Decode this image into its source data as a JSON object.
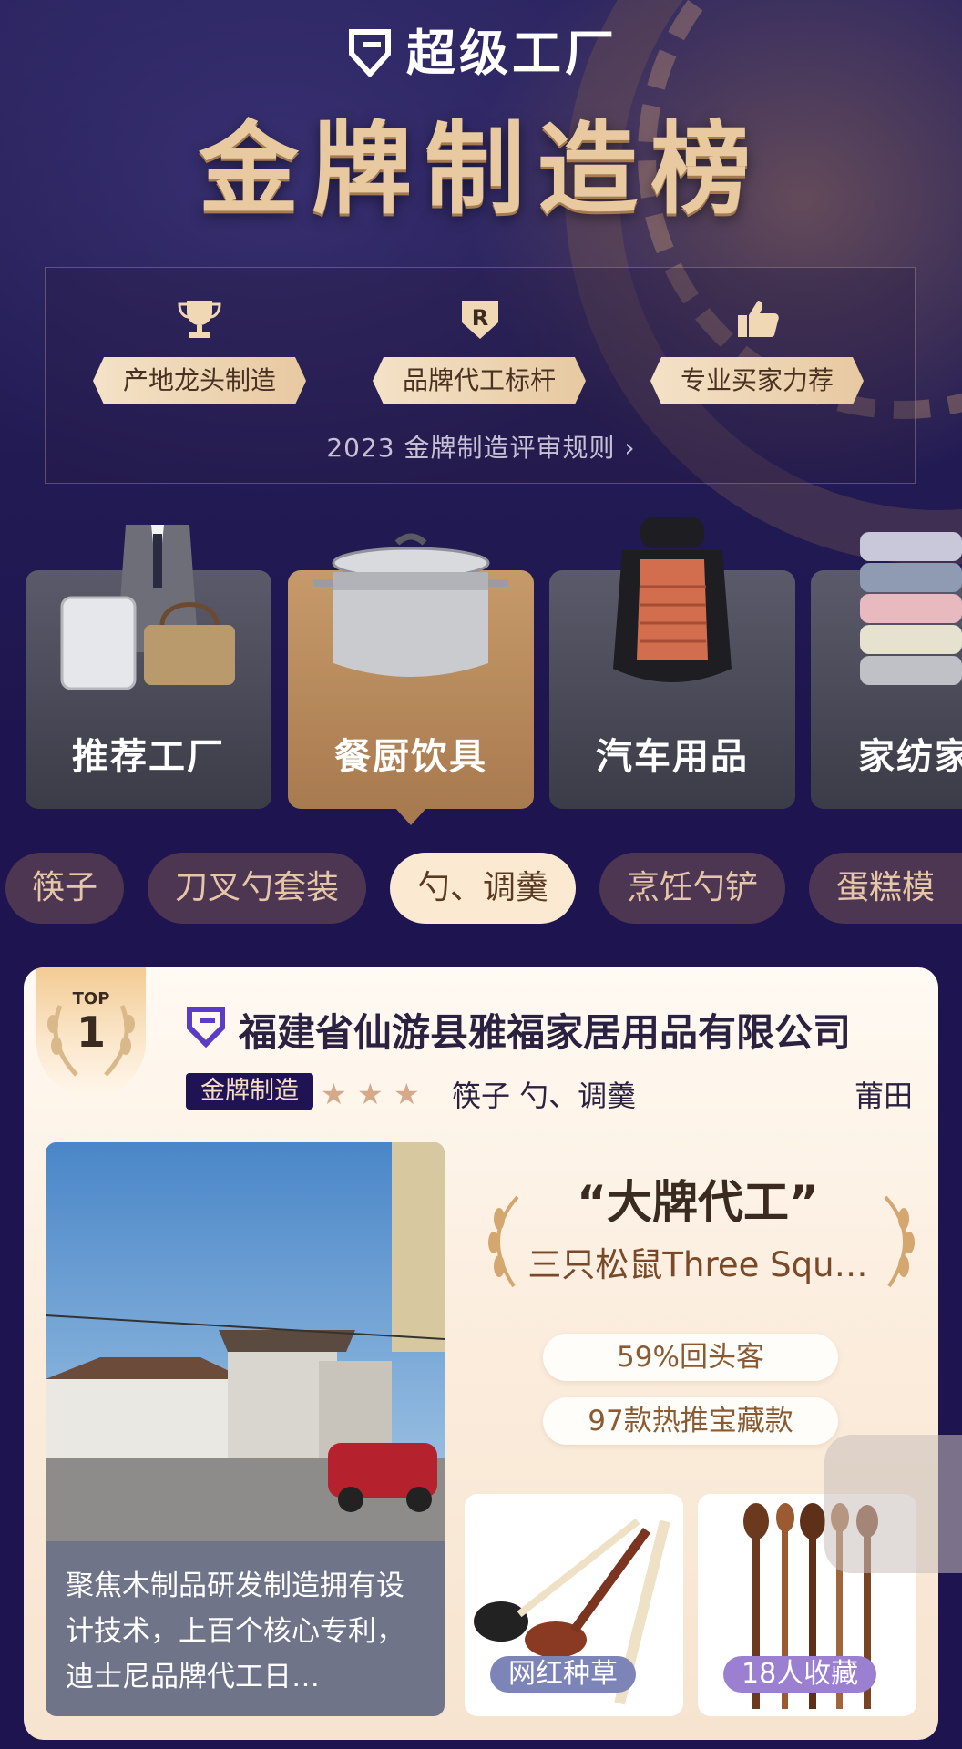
{
  "header": {
    "brand": "超级工厂",
    "title": "金牌制造榜",
    "badges": [
      {
        "icon": "trophy-icon",
        "label": "产地龙头制造"
      },
      {
        "icon": "registered-shield-icon",
        "label": "品牌代工标杆"
      },
      {
        "icon": "thumbs-up-icon",
        "label": "专业买家力荐"
      }
    ],
    "rules_link": "2023 金牌制造评审规则 ›"
  },
  "categories": [
    {
      "label": "推荐工厂",
      "icon": "suit-luggage-icon",
      "active": false
    },
    {
      "label": "餐厨饮具",
      "icon": "stockpot-icon",
      "active": true
    },
    {
      "label": "汽车用品",
      "icon": "car-seat-icon",
      "active": false
    },
    {
      "label": "家纺家",
      "icon": "towels-icon",
      "active": false
    }
  ],
  "subcategories": [
    {
      "label": "筷子",
      "active": false
    },
    {
      "label": "刀叉勺套装",
      "active": false
    },
    {
      "label": "勺、调羹",
      "active": true
    },
    {
      "label": "烹饪勺铲",
      "active": false
    },
    {
      "label": "蛋糕模",
      "active": false
    }
  ],
  "factory_card": {
    "rank_top": "TOP",
    "rank_num": "1",
    "company": "福建省仙游县雅福家居用品有限公司",
    "tag": "金牌制造",
    "stars": 3,
    "star_glyph": "★",
    "categories": "筷子 勺、调羹",
    "region": "莆田",
    "description": "聚焦木制品研发制造拥有设计技术，上百个核心专利，迪士尼品牌代工日…",
    "quote_title": "“大牌代工”",
    "quote_brand": "三只松鼠Three Squ…",
    "stats": [
      "59%回头客",
      "97款热推宝藏款"
    ],
    "thumbs": [
      {
        "tag": "网红种草",
        "tag_color": "#7d84b8"
      },
      {
        "tag": "18人收藏",
        "tag_color": "#9b7fd1"
      }
    ]
  }
}
